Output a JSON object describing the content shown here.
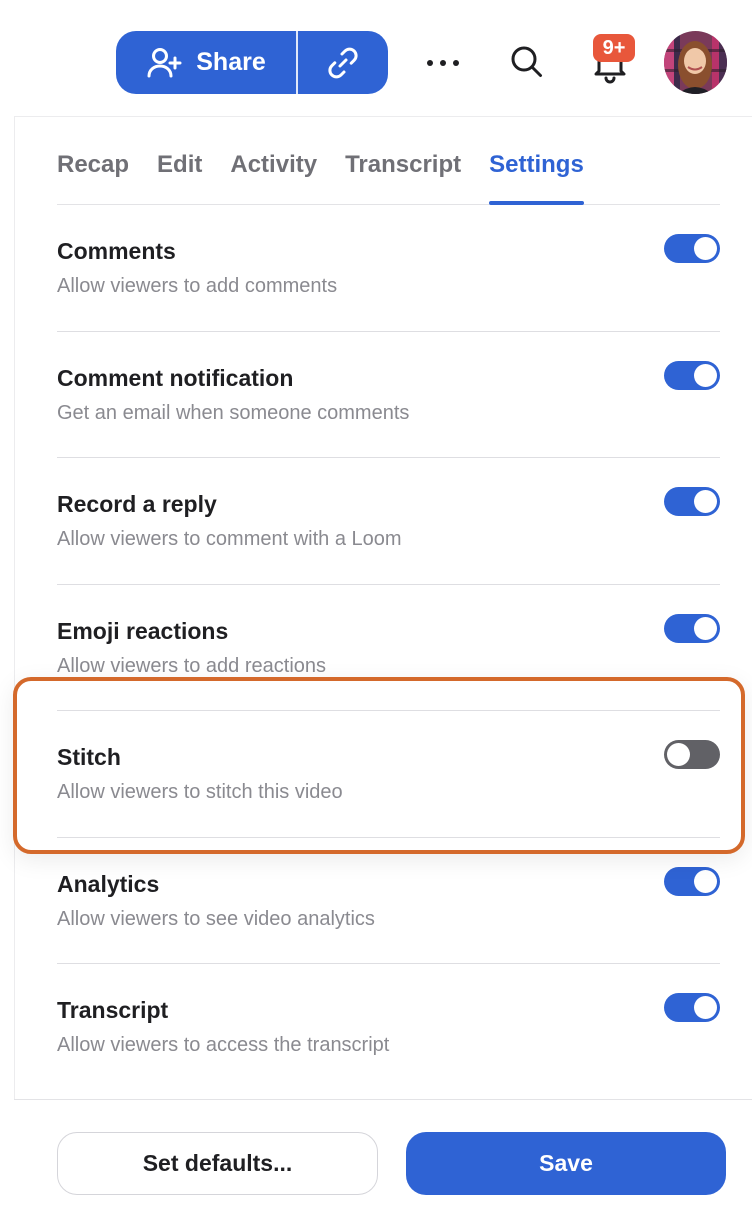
{
  "header": {
    "share_label": "Share",
    "share_icon": "user-plus-icon",
    "copy_link_icon": "link-icon",
    "more_icon": "more-horizontal-icon",
    "search_icon": "search-icon",
    "notifications_icon": "bell-icon",
    "notification_badge": "9+",
    "avatar_alt": "User avatar"
  },
  "tabs": [
    {
      "label": "Recap",
      "active": false
    },
    {
      "label": "Edit",
      "active": false
    },
    {
      "label": "Activity",
      "active": false
    },
    {
      "label": "Transcript",
      "active": false
    },
    {
      "label": "Settings",
      "active": true
    }
  ],
  "settings": [
    {
      "title": "Comments",
      "description": "Allow viewers to add comments",
      "enabled": true
    },
    {
      "title": "Comment notification",
      "description": "Get an email when someone comments",
      "enabled": true
    },
    {
      "title": "Record a reply",
      "description": "Allow viewers to comment with a Loom",
      "enabled": true
    },
    {
      "title": "Emoji reactions",
      "description": "Allow viewers to add reactions",
      "enabled": true
    },
    {
      "title": "Stitch",
      "description": "Allow viewers to stitch this video",
      "enabled": false,
      "highlighted": true
    },
    {
      "title": "Analytics",
      "description": "Allow viewers to see video analytics",
      "enabled": true
    },
    {
      "title": "Transcript",
      "description": "Allow viewers to access the transcript",
      "enabled": true
    }
  ],
  "footer": {
    "set_defaults_label": "Set defaults...",
    "save_label": "Save"
  },
  "colors": {
    "accent": "#2f63d4",
    "toggle_off": "#616166",
    "highlight": "#d4692b",
    "badge": "#e8573b"
  }
}
